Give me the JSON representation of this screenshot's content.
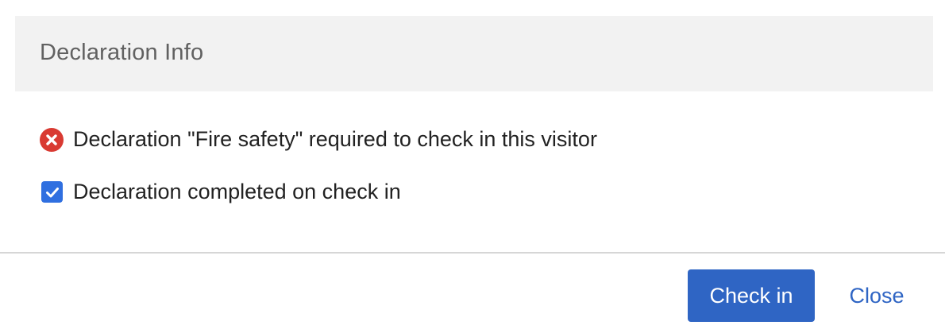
{
  "dialog": {
    "header": {
      "title": "Declaration Info"
    },
    "messages": {
      "error_text": "Declaration \"Fire safety\" required to check in this visitor",
      "error_icon": "error-circle-x-icon",
      "checkbox_label": "Declaration completed on check in",
      "checkbox_checked": true
    },
    "footer": {
      "primary_label": "Check in",
      "close_label": "Close"
    }
  },
  "colors": {
    "header_bg": "#f2f2f2",
    "error_red": "#d93a32",
    "accent_blue": "#2f65c4",
    "checkbox_blue": "#2f6fe0",
    "divider": "#d6d6d6"
  }
}
